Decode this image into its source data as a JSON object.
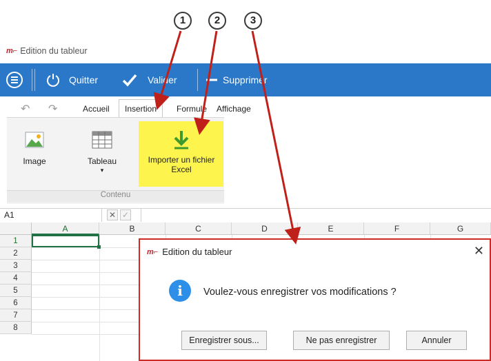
{
  "callouts": [
    "1",
    "2",
    "3"
  ],
  "window": {
    "logo": "m⌐",
    "title": "Edition du tableur"
  },
  "toolbar": {
    "menu_icon": "hamburger-circle-icon",
    "quit_label": "Quitter",
    "validate_label": "Valider",
    "delete_label": "Supprimer"
  },
  "tabs": {
    "home": "Accueil",
    "insert": "Insertion",
    "formula": "Formule",
    "display": "Affichage"
  },
  "ribbon": {
    "image_label": "Image",
    "table_label": "Tableau",
    "table_caret": "▾",
    "import_label_line1": "Importer un fichier",
    "import_label_line2": "Excel",
    "group_label": "Contenu"
  },
  "formula_bar": {
    "name_box": "A1",
    "cancel": "✕",
    "confirm": "✓"
  },
  "grid": {
    "columns": [
      "A",
      "B",
      "C",
      "D",
      "E",
      "F",
      "G"
    ],
    "rows": [
      "1",
      "2",
      "3",
      "4",
      "5",
      "6",
      "7",
      "8"
    ]
  },
  "dialog": {
    "logo": "m⌐",
    "title": "Edition du tableur",
    "close": "✕",
    "message": "Voulez-vous enregistrer vos modifications ?",
    "save_as": "Enregistrer sous...",
    "dont_save": "Ne pas enregistrer",
    "cancel": "Annuler"
  },
  "colors": {
    "toolbar": "#2b78c9",
    "highlight": "#fdf44d",
    "arrow": "#c0201a",
    "info": "#2d8fe8"
  }
}
